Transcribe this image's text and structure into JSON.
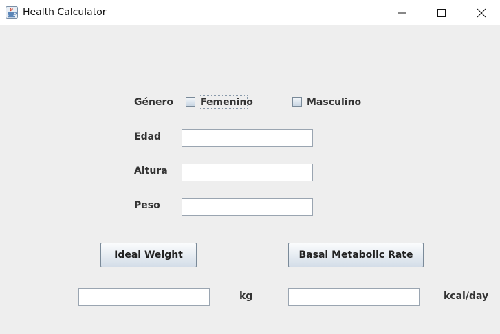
{
  "window": {
    "title": "Health Calculator",
    "icon": "java-cup-icon",
    "controls": [
      "minimize-icon",
      "maximize-icon",
      "close-icon"
    ]
  },
  "form": {
    "genero_label": "Género",
    "femenino_label": "Femenino",
    "masculino_label": "Masculino",
    "femenino_checked": false,
    "masculino_checked": false,
    "edad_label": "Edad",
    "edad_value": "",
    "altura_label": "Altura",
    "altura_value": "",
    "peso_label": "Peso",
    "peso_value": ""
  },
  "actions": {
    "ideal_weight_label": "Ideal Weight",
    "bmr_label": "Basal Metabolic Rate"
  },
  "results": {
    "ideal_weight_value": "",
    "ideal_weight_unit": "kg",
    "bmr_value": "",
    "bmr_unit": "kcal/day"
  }
}
